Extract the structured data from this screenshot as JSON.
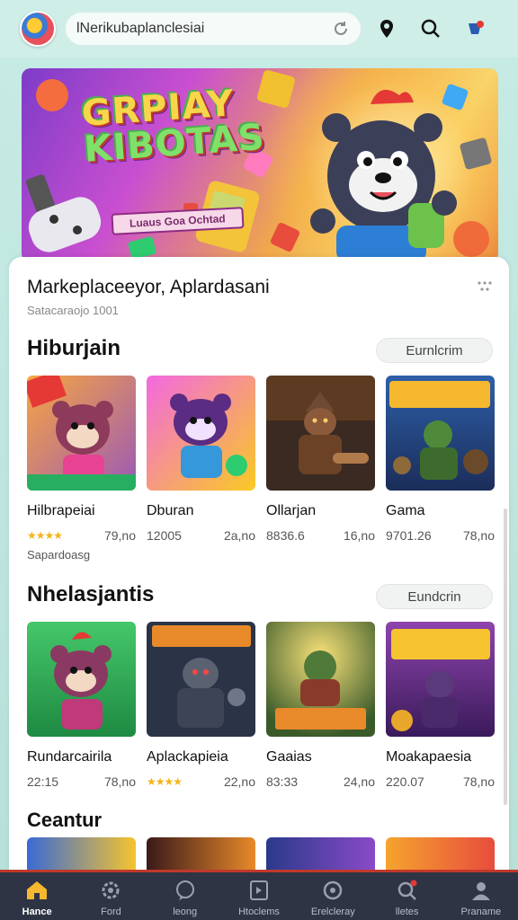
{
  "header": {
    "search_value": "lNerikubaplanclesiai",
    "icons": [
      "app-logo",
      "refresh-icon",
      "location-pin-icon",
      "search-icon",
      "notification-badge-icon"
    ]
  },
  "banner": {
    "title_line1": "GRPIAY",
    "title_line2": "KIBOTAS",
    "subtitle": "Luaus Goa Ochtad"
  },
  "marketplace": {
    "title": "Markeplaceeyor, Aplardasani",
    "subtitle": "Satacaraojo 1001"
  },
  "sections": [
    {
      "title": "Hiburjain",
      "button": "Eurnlcrim",
      "items": [
        {
          "name": "Hilbrapeiai",
          "stars": "★★★★",
          "rating": "",
          "price": "79,no"
        },
        {
          "name": "Dburan",
          "stars": "",
          "rating": "12005",
          "price": "2a,no"
        },
        {
          "name": "Ollarjan",
          "stars": "",
          "rating": "8836.6",
          "price": "16,no"
        },
        {
          "name": "Gama",
          "stars": "",
          "rating": "9701.26",
          "price": "78,no"
        }
      ],
      "extra": "Sapardoasg"
    },
    {
      "title": "Nhelasjantis",
      "button": "Eundcrin",
      "items": [
        {
          "name": "Rundarcairila",
          "stars": "",
          "rating": "22:15",
          "price": "78,no"
        },
        {
          "name": "Aplackapieia",
          "stars": "★★★★",
          "rating": "",
          "price": "22,no"
        },
        {
          "name": "Gaaias",
          "stars": "",
          "rating": "83:33",
          "price": "24,no"
        },
        {
          "name": "Moakapaesia",
          "stars": "",
          "rating": "220.07",
          "price": "78,no"
        }
      ]
    },
    {
      "title": "Ceantur"
    }
  ],
  "nav": [
    {
      "label": "Hance",
      "icon": "home-icon",
      "active": true
    },
    {
      "label": "Ford",
      "icon": "gear-icon",
      "active": false
    },
    {
      "label": "leong",
      "icon": "chat-icon",
      "active": false
    },
    {
      "label": "Htoclems",
      "icon": "box-icon",
      "active": false
    },
    {
      "label": "Erelcleray",
      "icon": "refresh-circle-icon",
      "active": false
    },
    {
      "label": "lletes",
      "icon": "search-alert-icon",
      "active": false
    },
    {
      "label": "Praname",
      "icon": "profile-icon",
      "active": false
    }
  ],
  "colors": {
    "accent": "#c0392b",
    "nav_bg": "#2f3445",
    "star": "#f3b41b",
    "bg": "#bfe6df"
  }
}
